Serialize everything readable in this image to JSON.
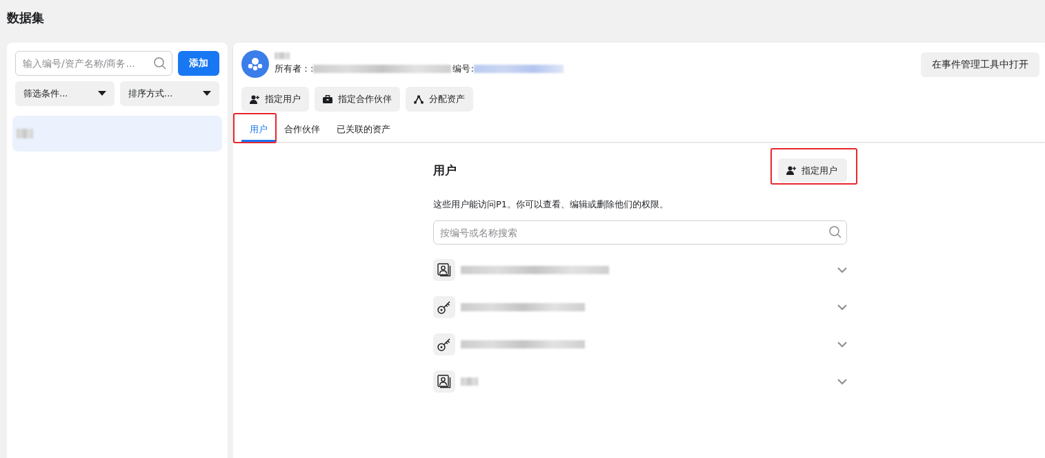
{
  "page_title": "数据集",
  "sidebar": {
    "search": {
      "placeholder": "输入编号/资产名称/商务..."
    },
    "add_button": "添加",
    "filters": [
      {
        "label": "筛选条件..."
      },
      {
        "label": "排序方式..."
      }
    ],
    "items": [
      {
        "selected": true
      }
    ]
  },
  "asset": {
    "owner_label": "所有者：:",
    "id_label": "编号:",
    "open_button": "在事件管理工具中打开",
    "actions": [
      {
        "kind": "user",
        "label": "指定用户"
      },
      {
        "kind": "partner",
        "label": "指定合作伙伴"
      },
      {
        "kind": "asset",
        "label": "分配资产"
      }
    ],
    "tabs": [
      {
        "label": "用户",
        "selected": true,
        "highlighted": true
      },
      {
        "label": "合作伙伴",
        "selected": false,
        "highlighted": false
      },
      {
        "label": "已关联的资产",
        "selected": false,
        "highlighted": false
      }
    ]
  },
  "users_panel": {
    "title": "用户",
    "assign_button": {
      "label": "指定用户",
      "highlighted": true
    },
    "description": "这些用户能访问P1。你可以查看、编辑或删除他们的权限。",
    "search": {
      "placeholder": "按编号或名称搜索"
    },
    "users": [
      {
        "kind": "person",
        "expanded": false
      },
      {
        "kind": "key",
        "expanded": false
      },
      {
        "kind": "key",
        "expanded": false
      },
      {
        "kind": "person",
        "expanded": false
      }
    ]
  }
}
